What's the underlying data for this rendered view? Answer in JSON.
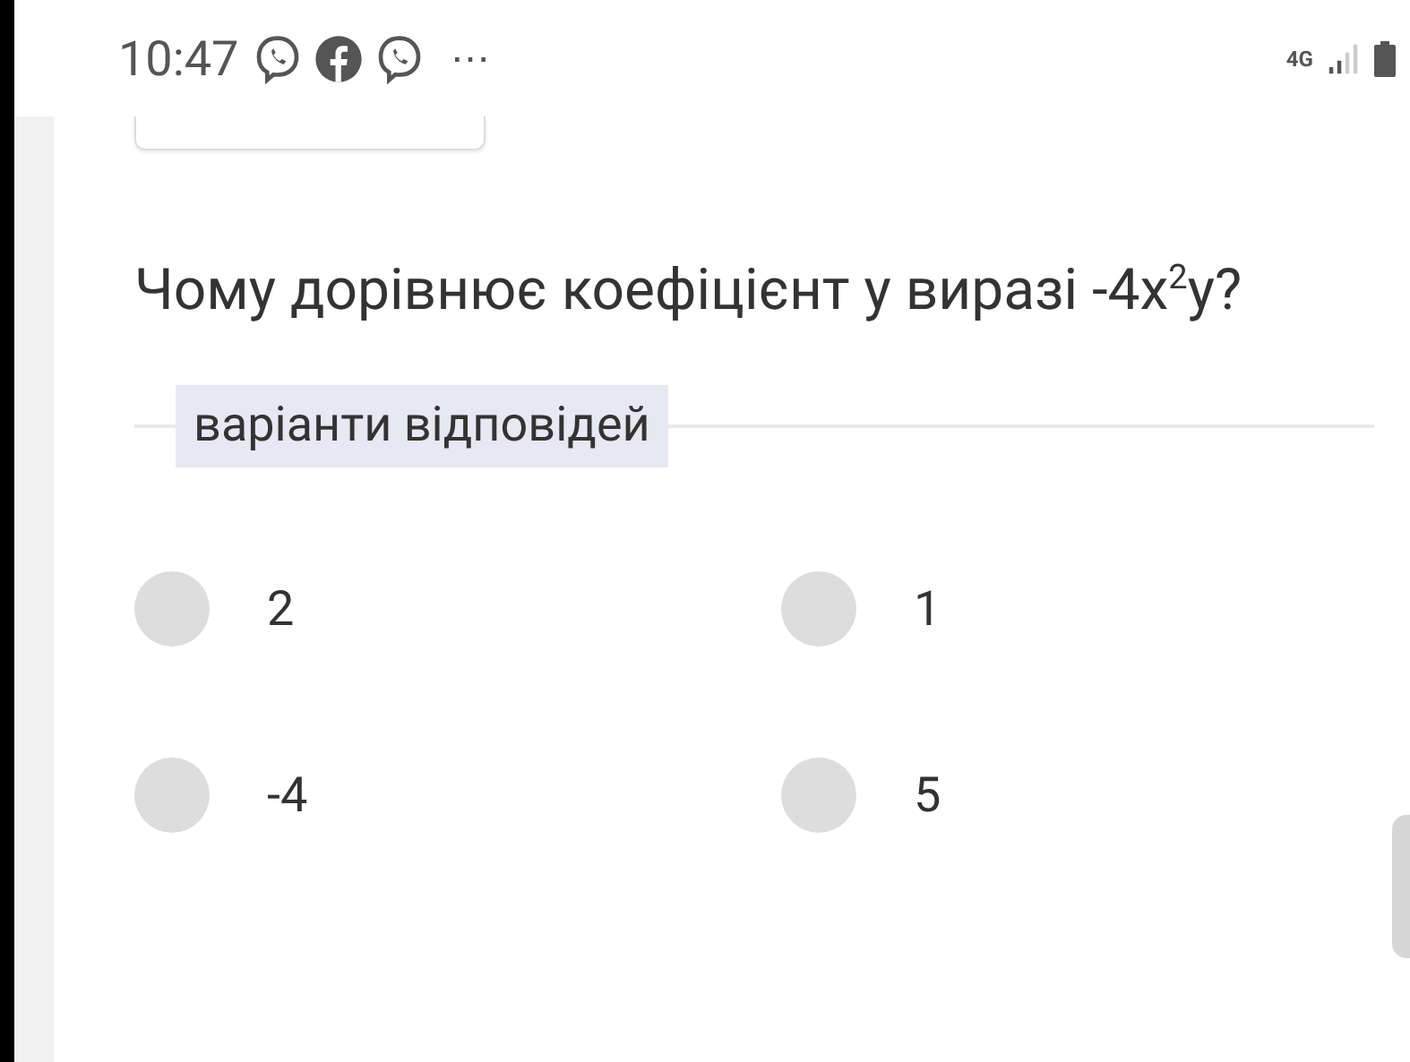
{
  "status_bar": {
    "time": "10:47",
    "more": "⋯",
    "network": "4G"
  },
  "question": {
    "text": "Чому дорівнює коефіцієнт у виразі -4x$^{2}$y?"
  },
  "answers_section": {
    "label": "варіанти відповідей"
  },
  "options": [
    {
      "label": "2",
      "selected": false
    },
    {
      "label": "1",
      "selected": false
    },
    {
      "label": "-4",
      "selected": false
    },
    {
      "label": "5",
      "selected": false
    }
  ]
}
